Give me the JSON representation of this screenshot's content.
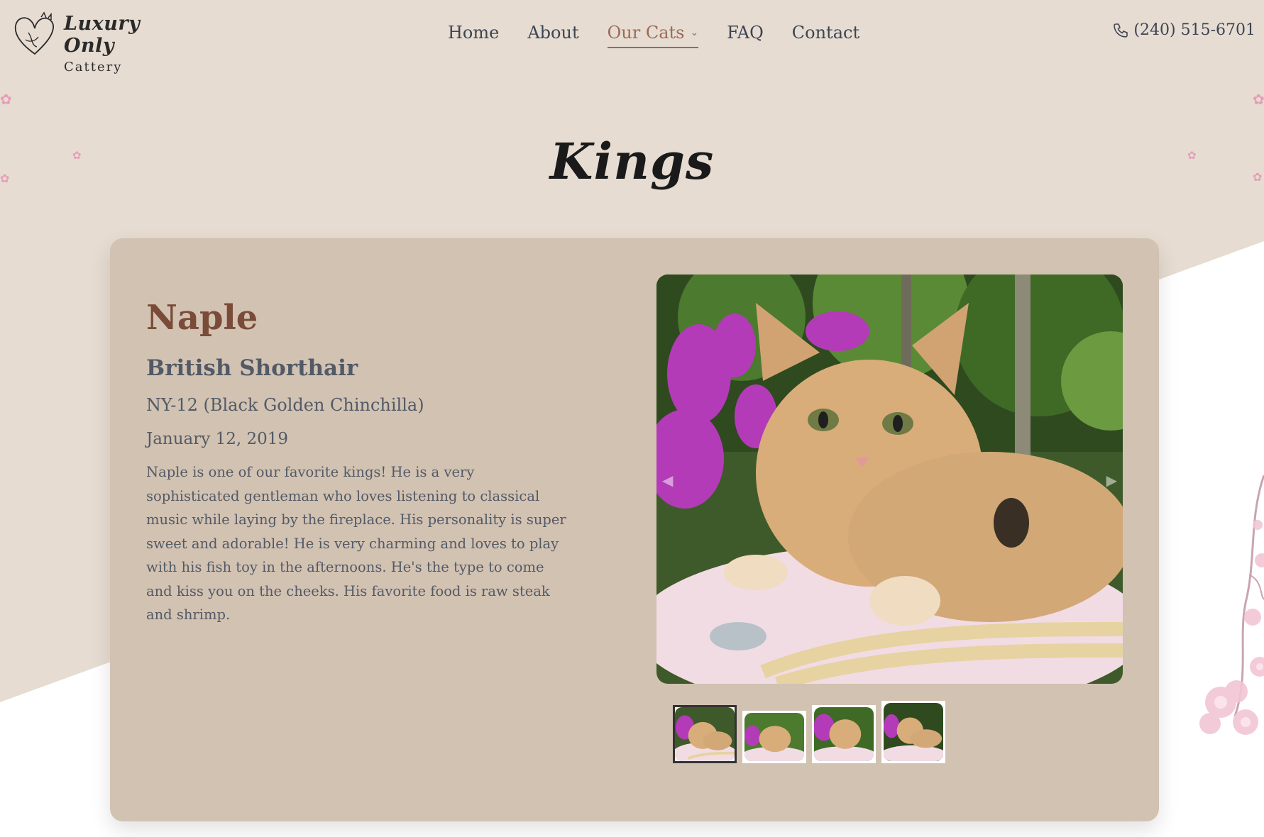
{
  "brand": {
    "name": "Luxury Only",
    "subtitle": "Cattery"
  },
  "nav": {
    "items": [
      {
        "label": "Home",
        "active": false
      },
      {
        "label": "About",
        "active": false
      },
      {
        "label": "Our Cats",
        "active": true,
        "has_dropdown": true
      },
      {
        "label": "FAQ",
        "active": false
      },
      {
        "label": "Contact",
        "active": false
      }
    ]
  },
  "phone": {
    "number": "(240) 515-6701",
    "icon": "phone-icon"
  },
  "page": {
    "title": "Kings"
  },
  "cat": {
    "name": "Naple",
    "breed": "British Shorthair",
    "color_code": "NY-12 (Black Golden Chinchilla)",
    "birth_date": "January 12, 2019",
    "description": "Naple is one of our favorite kings! He is a very sophisticated gentleman who loves listening to classical music while laying by the fireplace. His personality is super sweet and adorable! He is very charming and loves to play with his fish toy in the afternoons. He's the type to come and kiss you on the cheeks. His favorite food is raw steak and shrimp."
  },
  "gallery": {
    "thumbnail_count": 4,
    "active_index": 0,
    "prev_icon": "chevron-left-icon",
    "next_icon": "chevron-right-icon"
  },
  "colors": {
    "accent": "#9b6a55",
    "card": "#d2c2b2",
    "page_bg": "#e6dcd2",
    "name": "#7a4b38"
  }
}
